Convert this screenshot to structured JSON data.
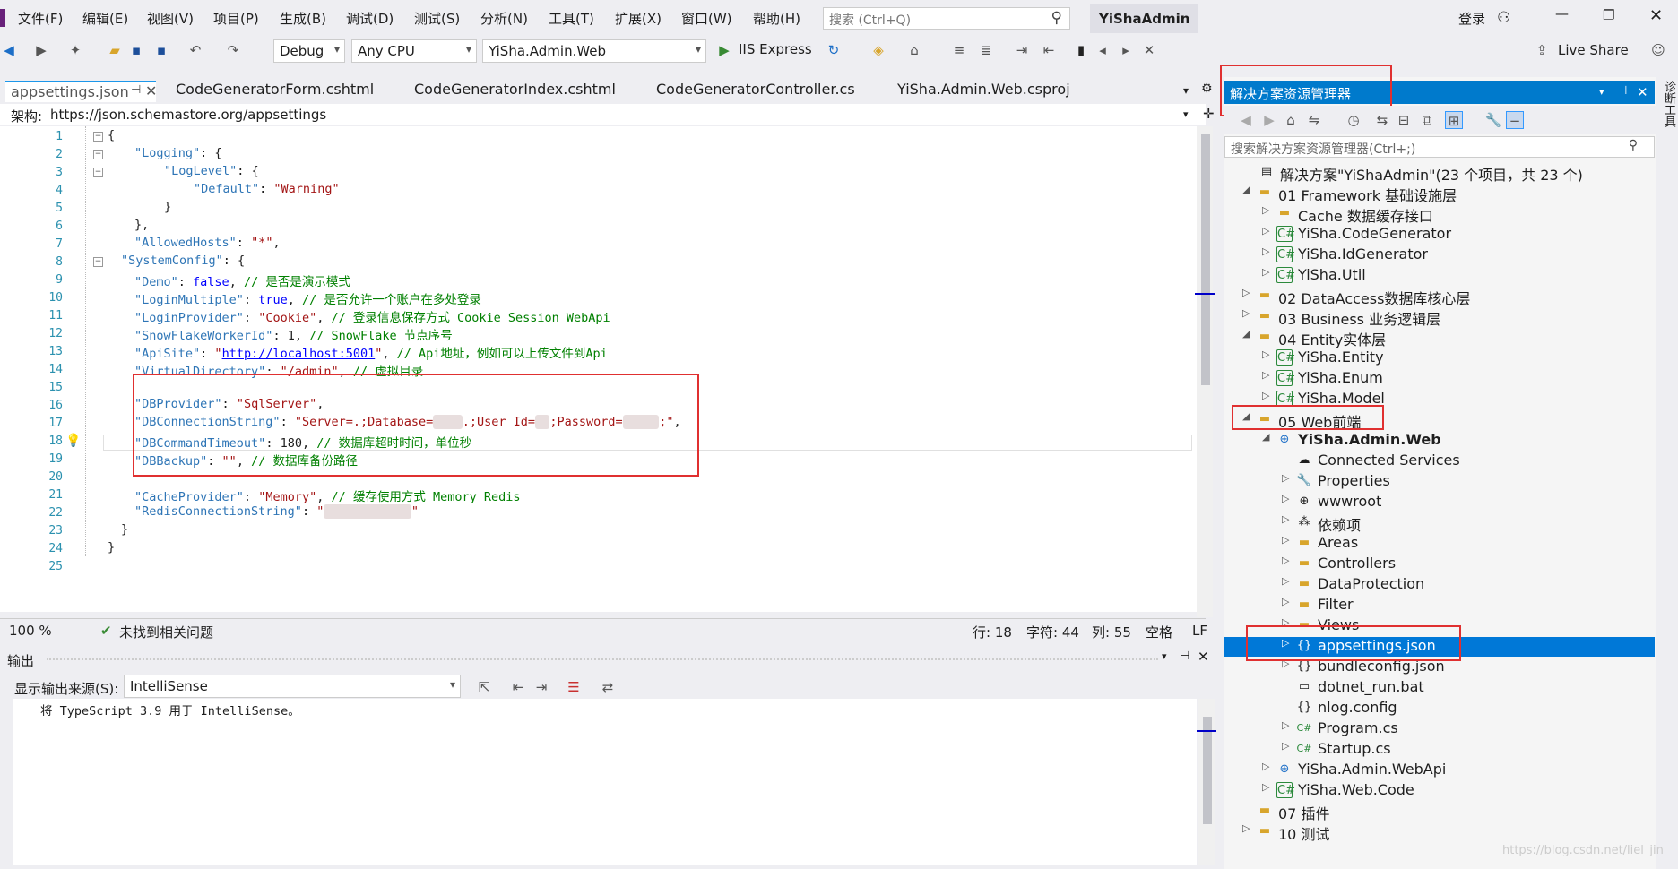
{
  "menu": [
    "文件(F)",
    "编辑(E)",
    "视图(V)",
    "项目(P)",
    "生成(B)",
    "调试(D)",
    "测试(S)",
    "分析(N)",
    "工具(T)",
    "扩展(X)",
    "窗口(W)",
    "帮助(H)"
  ],
  "search": {
    "placeholder": "搜索 (Ctrl+Q)"
  },
  "solution_name": "YiShaAdmin",
  "login": "登录",
  "live_share": "Live Share",
  "toolbar": {
    "config": "Debug",
    "platform": "Any CPU",
    "startup_project": "YiSha.Admin.Web",
    "run_label": "IIS Express"
  },
  "tabs": [
    "appsettings.json",
    "CodeGeneratorForm.cshtml",
    "CodeGeneratorIndex.cshtml",
    "CodeGeneratorController.cs",
    "YiSha.Admin.Web.csproj"
  ],
  "schema": {
    "label": "架构:",
    "url": "https://json.schemastore.org/appsettings"
  },
  "code_lines": [
    "1",
    "2",
    "3",
    "4",
    "5",
    "6",
    "7",
    "8",
    "9",
    "10",
    "11",
    "12",
    "13",
    "14",
    "15",
    "16",
    "17",
    "18",
    "19",
    "20",
    "21",
    "22",
    "23",
    "24",
    "25"
  ],
  "status": {
    "zoom": "100 %",
    "issues": "未找到相关问题",
    "line": "行: 18",
    "char": "字符: 44",
    "col": "列: 55",
    "ws": "空格",
    "eol": "LF"
  },
  "output": {
    "title": "输出",
    "source_label": "显示输出来源(S):",
    "source_value": "IntelliSense",
    "text": "将 TypeScript 3.9 用于 IntelliSense。"
  },
  "solution_explorer": {
    "title": "解决方案资源管理器",
    "search_placeholder": "搜索解决方案资源管理器(Ctrl+;)",
    "items": [
      {
        "label": "解决方案\"YiShaAdmin\"(23 个项目，共 23 个)"
      },
      {
        "label": "01 Framework 基础设施层"
      },
      {
        "label": "Cache 数据缓存接口"
      },
      {
        "label": "YiSha.CodeGenerator"
      },
      {
        "label": "YiSha.IdGenerator"
      },
      {
        "label": "YiSha.Util"
      },
      {
        "label": "02 DataAccess数据库核心层"
      },
      {
        "label": "03 Business 业务逻辑层"
      },
      {
        "label": "04 Entity实体层"
      },
      {
        "label": "YiSha.Entity"
      },
      {
        "label": "YiSha.Enum"
      },
      {
        "label": "YiSha.Model"
      },
      {
        "label": "05 Web前端"
      },
      {
        "label": "YiSha.Admin.Web"
      },
      {
        "label": "Connected Services"
      },
      {
        "label": "Properties"
      },
      {
        "label": "wwwroot"
      },
      {
        "label": "依赖项"
      },
      {
        "label": "Areas"
      },
      {
        "label": "Controllers"
      },
      {
        "label": "DataProtection"
      },
      {
        "label": "Filter"
      },
      {
        "label": "Views"
      },
      {
        "label": "appsettings.json"
      },
      {
        "label": "bundleconfig.json"
      },
      {
        "label": "dotnet_run.bat"
      },
      {
        "label": "nlog.config"
      },
      {
        "label": "Program.cs"
      },
      {
        "label": "Startup.cs"
      },
      {
        "label": "YiSha.Admin.WebApi"
      },
      {
        "label": "YiSha.Web.Code"
      },
      {
        "label": "07 插件"
      },
      {
        "label": "10 测试"
      }
    ]
  },
  "right_strip": "诊断工具",
  "watermark": "https://blog.csdn.net/liel_jin"
}
